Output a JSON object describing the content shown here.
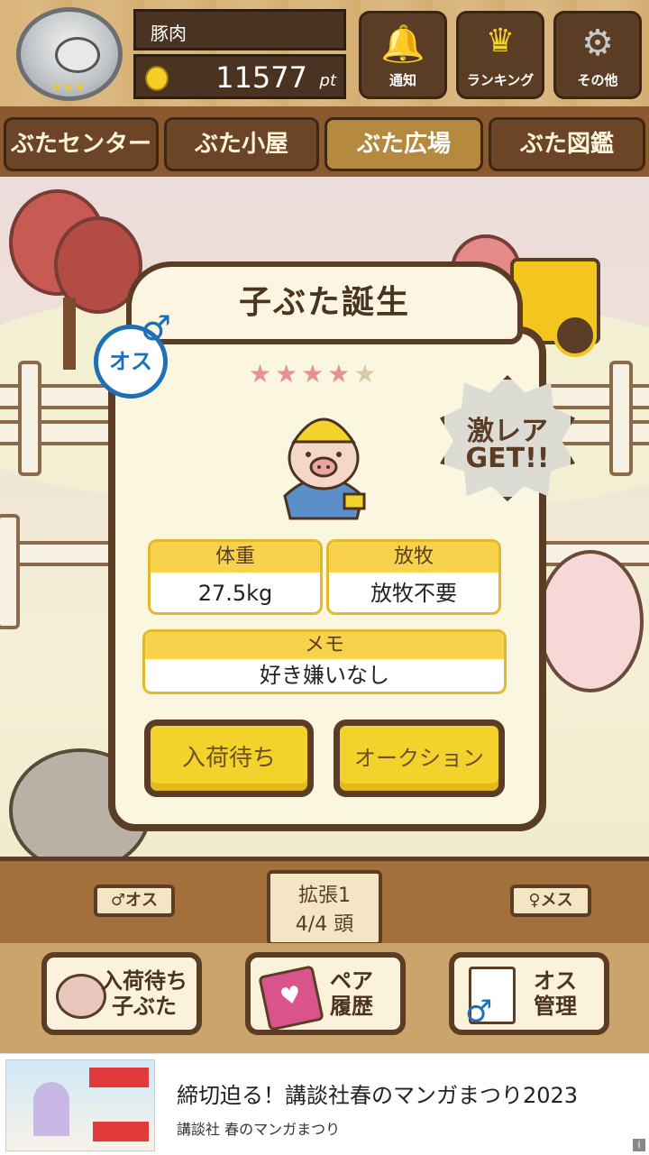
{
  "header": {
    "player_name": "豚肉",
    "points": "11577",
    "points_unit": "pt",
    "rank_stars": "★★★",
    "buttons": [
      {
        "label": "通知",
        "icon": "bell-icon"
      },
      {
        "label": "ランキング",
        "icon": "crown-icon"
      },
      {
        "label": "その他",
        "icon": "gear-icon"
      }
    ]
  },
  "tabs": [
    {
      "label": "ぶたセンター",
      "active": false
    },
    {
      "label": "ぶた小屋",
      "active": false
    },
    {
      "label": "ぶた広場",
      "active": true
    },
    {
      "label": "ぶた図鑑",
      "active": false
    }
  ],
  "modal": {
    "title": "子ぶた誕生",
    "gender_badge": "オス",
    "rare_badge_line1": "激レア",
    "rare_badge_line2": "GET!!",
    "rarity_filled": "★★★★",
    "rarity_empty": "★",
    "weight_label": "体重",
    "weight_value": "27.5kg",
    "grazing_label": "放牧",
    "grazing_value": "放牧不要",
    "memo_label": "メモ",
    "memo_value": "好き嫌いなし",
    "btn_wait": "入荷待ち",
    "btn_auction": "オークション"
  },
  "pen": {
    "male_sign": "♂オス",
    "female_sign": "♀メス",
    "expand_label": "拡張1",
    "capacity": "4/4 頭"
  },
  "bottom_nav": [
    {
      "line1": "入荷待ち",
      "line2": "子ぶた"
    },
    {
      "line1": "ペア",
      "line2": "履歴"
    },
    {
      "line1": "オス",
      "line2": "管理"
    }
  ],
  "ad": {
    "title": "締切迫る！講談社春のマンガまつり2023",
    "subtitle": "講談社 春のマンガまつり",
    "info_icon": "i"
  },
  "colors": {
    "wood_dark": "#5a3d24",
    "accent_yellow": "#f4d22c",
    "male_blue": "#1d6fb8",
    "star_pink": "#e79191"
  }
}
